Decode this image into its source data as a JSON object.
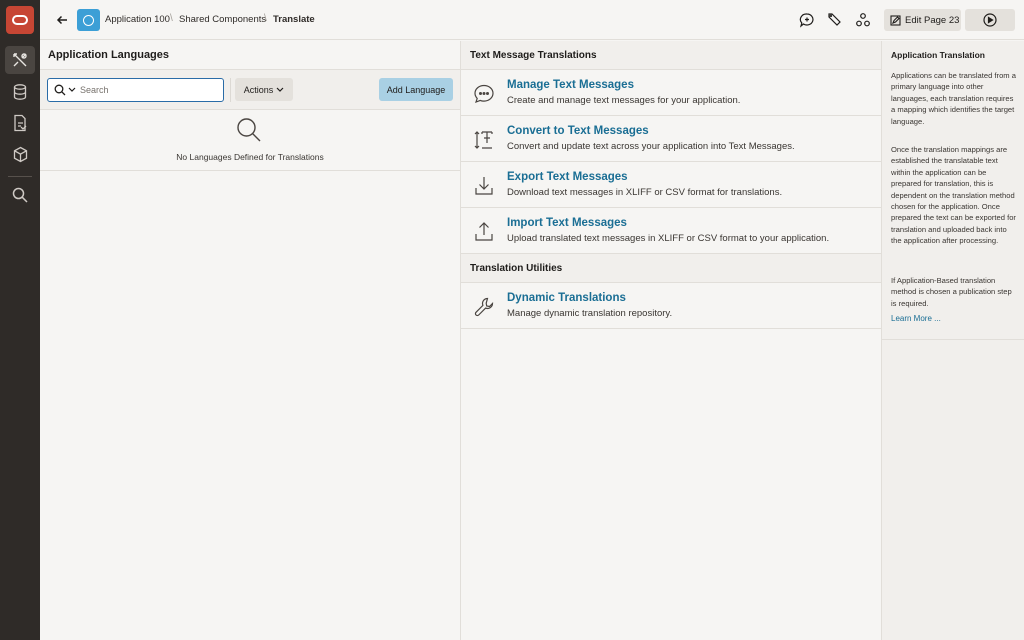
{
  "header": {
    "breadcrumbs": [
      {
        "label": "Application 100"
      },
      {
        "label": "Shared Components"
      },
      {
        "label": "Translate"
      }
    ],
    "edit_page_label": "Edit Page 23"
  },
  "left_panel": {
    "title": "Application Languages",
    "search_placeholder": "Search",
    "actions_label": "Actions",
    "add_language_label": "Add Language",
    "empty_message": "No Languages Defined for Translations"
  },
  "middle_panel": {
    "sections": [
      {
        "title": "Text Message Translations",
        "items": [
          {
            "title": "Manage Text Messages",
            "desc": "Create and manage text messages for your application.",
            "icon": "chat-bubble-icon"
          },
          {
            "title": "Convert to Text Messages",
            "desc": "Convert and update text across your application into Text Messages.",
            "icon": "convert-text-icon"
          },
          {
            "title": "Export Text Messages",
            "desc": "Download text messages in XLIFF or CSV format for translations.",
            "icon": "download-icon"
          },
          {
            "title": "Import Text Messages",
            "desc": "Upload translated text messages in XLIFF or CSV format to your application.",
            "icon": "upload-icon"
          }
        ]
      },
      {
        "title": "Translation Utilities",
        "items": [
          {
            "title": "Dynamic Translations",
            "desc": "Manage dynamic translation repository.",
            "icon": "wrench-icon"
          }
        ]
      }
    ]
  },
  "help_panel": {
    "title": "Application Translation",
    "paragraphs": [
      "Applications can be translated from a primary language into other languages, each translation requires a mapping which identifies the target language.",
      "Once the translation mappings are established the translatable text within the application can be prepared for translation, this is dependent on the translation method chosen for the application. Once prepared the text can be exported for translation and uploaded back into the application after processing.",
      "If Application-Based translation method is chosen a publication step is required."
    ],
    "learn_more": "Learn More ..."
  },
  "colors": {
    "rail": "#2f2b28",
    "brand": "#c74634",
    "link": "#1a6e94",
    "primary_button": "#a9d0e4",
    "app_badge": "#3c9fd6"
  }
}
